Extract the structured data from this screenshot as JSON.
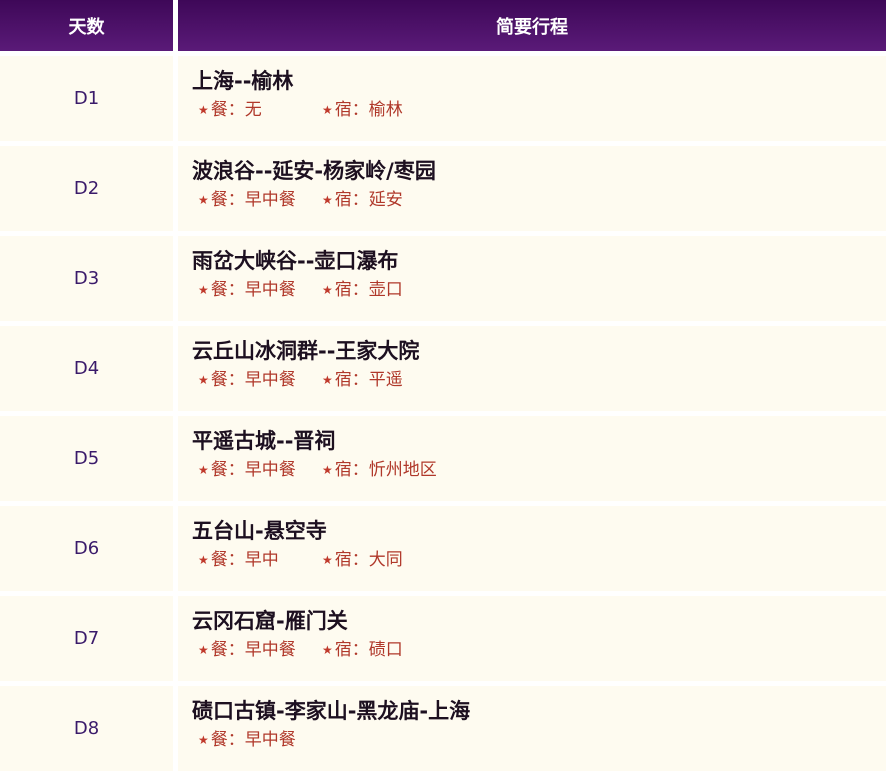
{
  "header": {
    "col_day": "天数",
    "col_itinerary": "简要行程"
  },
  "rows": [
    {
      "day": "D1",
      "title": "上海--榆林",
      "meal": "餐：无",
      "stay": "宿：榆林"
    },
    {
      "day": "D2",
      "title": "波浪谷--延安-杨家岭/枣园",
      "meal": "餐：早中餐",
      "stay": "宿：延安"
    },
    {
      "day": "D3",
      "title": "雨岔大峡谷--壶口瀑布",
      "meal": "餐：早中餐",
      "stay": "宿：壶口"
    },
    {
      "day": "D4",
      "title": "云丘山冰洞群--王家大院",
      "meal": "餐：早中餐",
      "stay": "宿：平遥"
    },
    {
      "day": "D5",
      "title": "平遥古城--晋祠",
      "meal": "餐：早中餐",
      "stay": "宿：忻州地区"
    },
    {
      "day": "D6",
      "title": "五台山-悬空寺",
      "meal": "餐：早中",
      "stay": "宿：大同"
    },
    {
      "day": "D7",
      "title": "云冈石窟-雁门关",
      "meal": "餐：早中餐",
      "stay": "宿：碛口"
    },
    {
      "day": "D8",
      "title": "碛口古镇-李家山-黑龙庙-上海",
      "meal": "餐：早中餐",
      "stay": ""
    }
  ],
  "star_glyph": "★"
}
